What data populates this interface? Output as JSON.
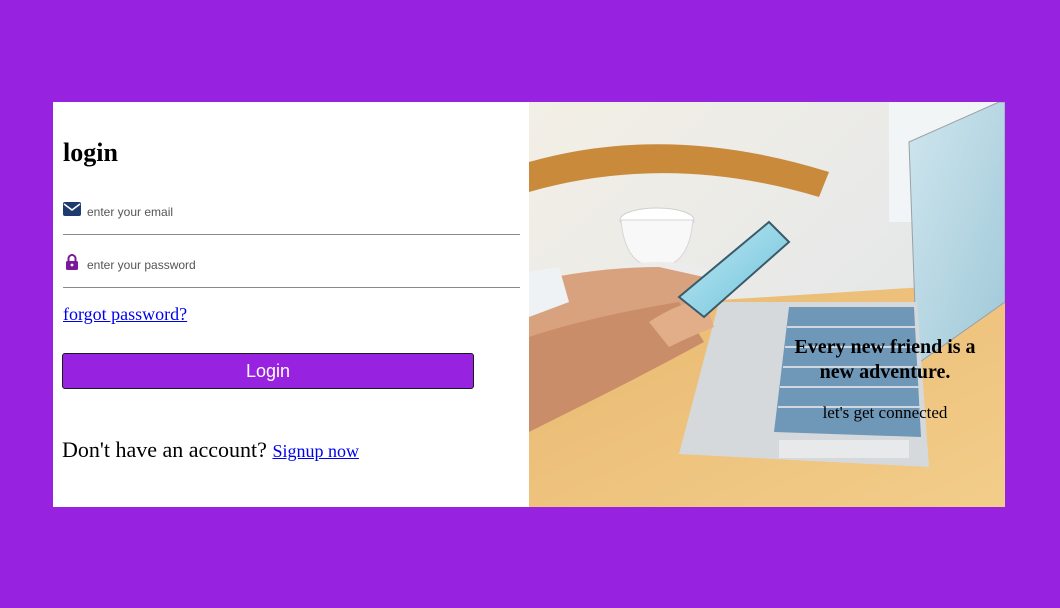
{
  "colors": {
    "page_background": "#9722e0",
    "button_background": "#9722e0",
    "button_text": "#ffffff",
    "link": "#0000ee",
    "email_icon": "#1e3a6e",
    "lock_icon": "#7a1a9a"
  },
  "login": {
    "title": "login",
    "email": {
      "icon": "envelope-icon",
      "placeholder": "enter your email",
      "value": ""
    },
    "password": {
      "icon": "lock-icon",
      "placeholder": "enter your password",
      "value": ""
    },
    "forgot_label": "forgot password?",
    "button_label": "Login",
    "signup_prompt": "Don't have an account?",
    "signup_link": "Signup now"
  },
  "hero": {
    "headline": "Every new friend is a new adventure.",
    "subtext": "let's get connected"
  }
}
